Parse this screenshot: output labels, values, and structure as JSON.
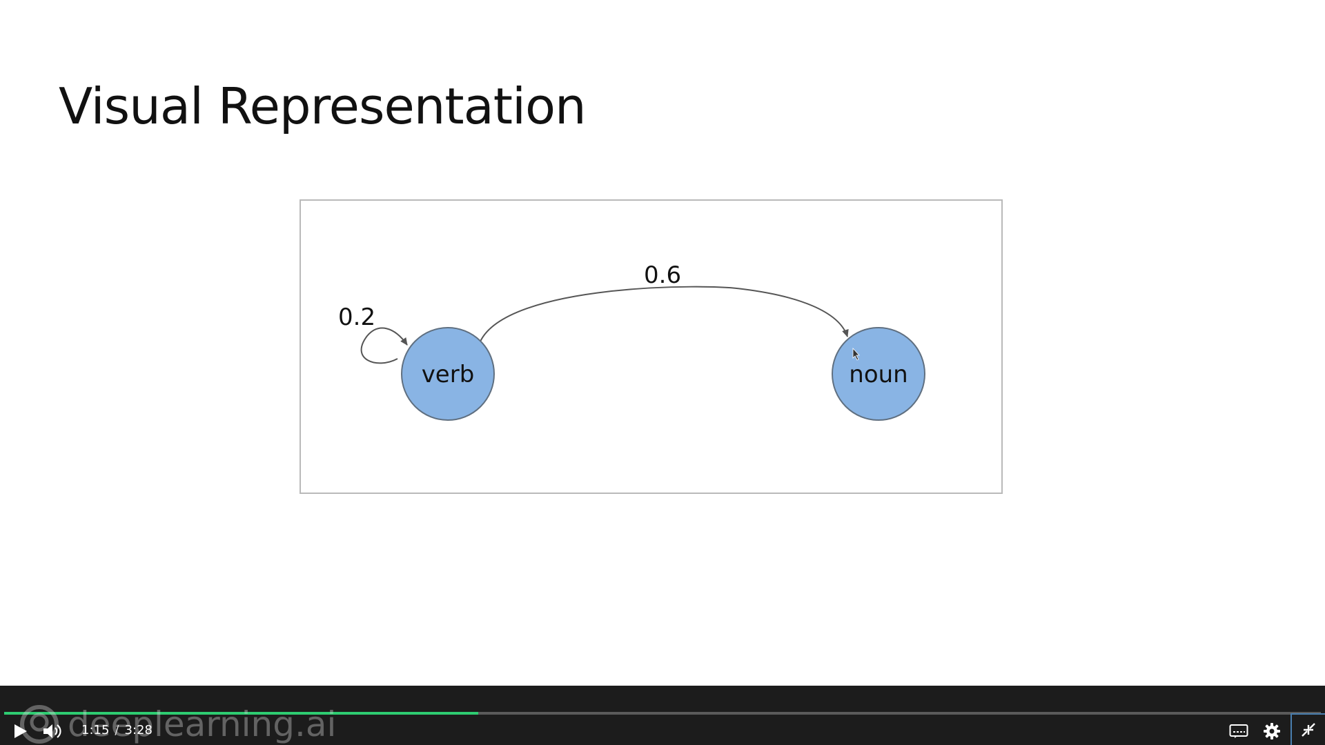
{
  "slide": {
    "title": "Visual Representation"
  },
  "diagram": {
    "nodes": [
      {
        "id": "verb",
        "label": "verb"
      },
      {
        "id": "noun",
        "label": "noun"
      }
    ],
    "edges": [
      {
        "from": "verb",
        "to": "verb",
        "label": "0.2"
      },
      {
        "from": "verb",
        "to": "noun",
        "label": "0.6"
      }
    ],
    "node_fill": "#89b4e4",
    "node_stroke": "#5f6f80"
  },
  "player": {
    "current_time": "1:15",
    "time_separator": "/",
    "duration": "3:28",
    "progress": 0.36,
    "watermark": "deeplearning.ai",
    "accent_color": "#2ecc71",
    "icons": {
      "play": "play-icon",
      "volume": "volume-icon",
      "captions": "captions-icon",
      "settings": "gear-icon",
      "exit_fullscreen": "exit-fullscreen-icon"
    }
  }
}
